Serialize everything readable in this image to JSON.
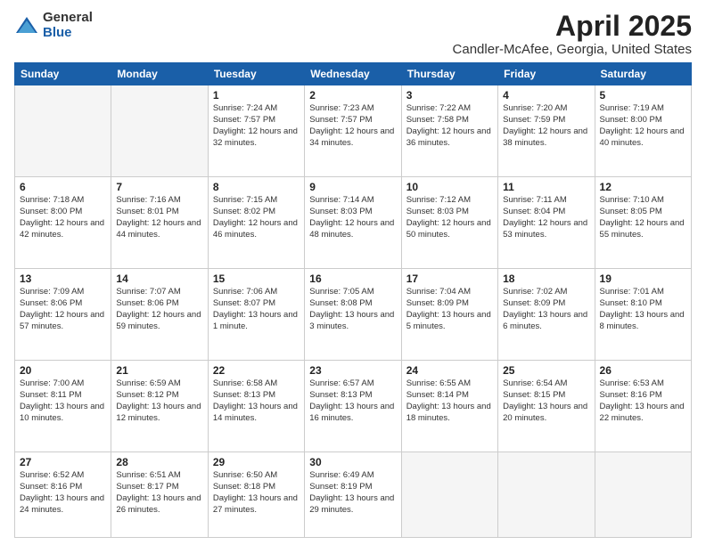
{
  "logo": {
    "general": "General",
    "blue": "Blue"
  },
  "title": "April 2025",
  "subtitle": "Candler-McAfee, Georgia, United States",
  "days_of_week": [
    "Sunday",
    "Monday",
    "Tuesday",
    "Wednesday",
    "Thursday",
    "Friday",
    "Saturday"
  ],
  "weeks": [
    [
      {
        "day": "",
        "info": ""
      },
      {
        "day": "",
        "info": ""
      },
      {
        "day": "1",
        "info": "Sunrise: 7:24 AM\nSunset: 7:57 PM\nDaylight: 12 hours\nand 32 minutes."
      },
      {
        "day": "2",
        "info": "Sunrise: 7:23 AM\nSunset: 7:57 PM\nDaylight: 12 hours\nand 34 minutes."
      },
      {
        "day": "3",
        "info": "Sunrise: 7:22 AM\nSunset: 7:58 PM\nDaylight: 12 hours\nand 36 minutes."
      },
      {
        "day": "4",
        "info": "Sunrise: 7:20 AM\nSunset: 7:59 PM\nDaylight: 12 hours\nand 38 minutes."
      },
      {
        "day": "5",
        "info": "Sunrise: 7:19 AM\nSunset: 8:00 PM\nDaylight: 12 hours\nand 40 minutes."
      }
    ],
    [
      {
        "day": "6",
        "info": "Sunrise: 7:18 AM\nSunset: 8:00 PM\nDaylight: 12 hours\nand 42 minutes."
      },
      {
        "day": "7",
        "info": "Sunrise: 7:16 AM\nSunset: 8:01 PM\nDaylight: 12 hours\nand 44 minutes."
      },
      {
        "day": "8",
        "info": "Sunrise: 7:15 AM\nSunset: 8:02 PM\nDaylight: 12 hours\nand 46 minutes."
      },
      {
        "day": "9",
        "info": "Sunrise: 7:14 AM\nSunset: 8:03 PM\nDaylight: 12 hours\nand 48 minutes."
      },
      {
        "day": "10",
        "info": "Sunrise: 7:12 AM\nSunset: 8:03 PM\nDaylight: 12 hours\nand 50 minutes."
      },
      {
        "day": "11",
        "info": "Sunrise: 7:11 AM\nSunset: 8:04 PM\nDaylight: 12 hours\nand 53 minutes."
      },
      {
        "day": "12",
        "info": "Sunrise: 7:10 AM\nSunset: 8:05 PM\nDaylight: 12 hours\nand 55 minutes."
      }
    ],
    [
      {
        "day": "13",
        "info": "Sunrise: 7:09 AM\nSunset: 8:06 PM\nDaylight: 12 hours\nand 57 minutes."
      },
      {
        "day": "14",
        "info": "Sunrise: 7:07 AM\nSunset: 8:06 PM\nDaylight: 12 hours\nand 59 minutes."
      },
      {
        "day": "15",
        "info": "Sunrise: 7:06 AM\nSunset: 8:07 PM\nDaylight: 13 hours\nand 1 minute."
      },
      {
        "day": "16",
        "info": "Sunrise: 7:05 AM\nSunset: 8:08 PM\nDaylight: 13 hours\nand 3 minutes."
      },
      {
        "day": "17",
        "info": "Sunrise: 7:04 AM\nSunset: 8:09 PM\nDaylight: 13 hours\nand 5 minutes."
      },
      {
        "day": "18",
        "info": "Sunrise: 7:02 AM\nSunset: 8:09 PM\nDaylight: 13 hours\nand 6 minutes."
      },
      {
        "day": "19",
        "info": "Sunrise: 7:01 AM\nSunset: 8:10 PM\nDaylight: 13 hours\nand 8 minutes."
      }
    ],
    [
      {
        "day": "20",
        "info": "Sunrise: 7:00 AM\nSunset: 8:11 PM\nDaylight: 13 hours\nand 10 minutes."
      },
      {
        "day": "21",
        "info": "Sunrise: 6:59 AM\nSunset: 8:12 PM\nDaylight: 13 hours\nand 12 minutes."
      },
      {
        "day": "22",
        "info": "Sunrise: 6:58 AM\nSunset: 8:13 PM\nDaylight: 13 hours\nand 14 minutes."
      },
      {
        "day": "23",
        "info": "Sunrise: 6:57 AM\nSunset: 8:13 PM\nDaylight: 13 hours\nand 16 minutes."
      },
      {
        "day": "24",
        "info": "Sunrise: 6:55 AM\nSunset: 8:14 PM\nDaylight: 13 hours\nand 18 minutes."
      },
      {
        "day": "25",
        "info": "Sunrise: 6:54 AM\nSunset: 8:15 PM\nDaylight: 13 hours\nand 20 minutes."
      },
      {
        "day": "26",
        "info": "Sunrise: 6:53 AM\nSunset: 8:16 PM\nDaylight: 13 hours\nand 22 minutes."
      }
    ],
    [
      {
        "day": "27",
        "info": "Sunrise: 6:52 AM\nSunset: 8:16 PM\nDaylight: 13 hours\nand 24 minutes."
      },
      {
        "day": "28",
        "info": "Sunrise: 6:51 AM\nSunset: 8:17 PM\nDaylight: 13 hours\nand 26 minutes."
      },
      {
        "day": "29",
        "info": "Sunrise: 6:50 AM\nSunset: 8:18 PM\nDaylight: 13 hours\nand 27 minutes."
      },
      {
        "day": "30",
        "info": "Sunrise: 6:49 AM\nSunset: 8:19 PM\nDaylight: 13 hours\nand 29 minutes."
      },
      {
        "day": "",
        "info": ""
      },
      {
        "day": "",
        "info": ""
      },
      {
        "day": "",
        "info": ""
      }
    ]
  ]
}
